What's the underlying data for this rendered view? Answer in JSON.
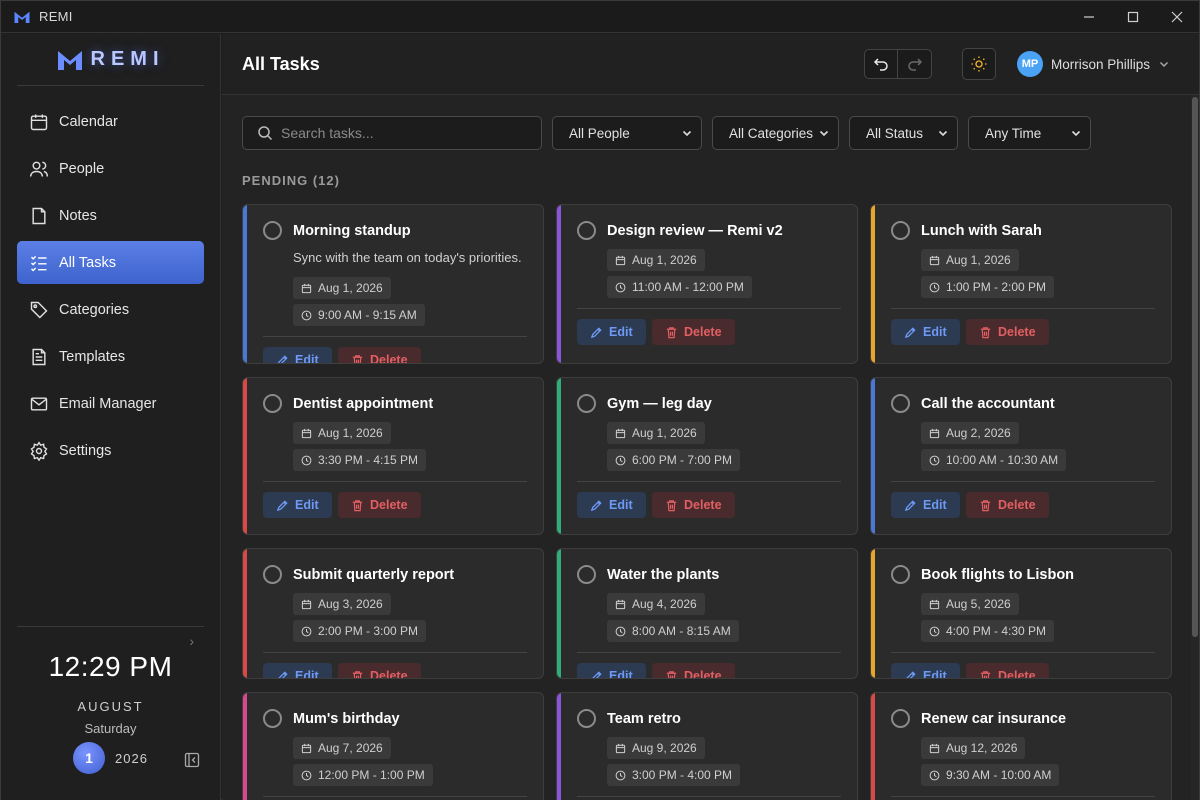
{
  "window": {
    "title": "REMI"
  },
  "brand": {
    "name": "REMI"
  },
  "sidebar": {
    "items": [
      {
        "label": "Calendar",
        "icon": "calendar-icon"
      },
      {
        "label": "People",
        "icon": "people-icon"
      },
      {
        "label": "Notes",
        "icon": "notes-icon"
      },
      {
        "label": "All Tasks",
        "icon": "tasks-icon",
        "active": true
      },
      {
        "label": "Categories",
        "icon": "tag-icon"
      },
      {
        "label": "Templates",
        "icon": "template-icon"
      },
      {
        "label": "Email Manager",
        "icon": "mail-icon"
      },
      {
        "label": "Settings",
        "icon": "gear-icon"
      }
    ],
    "clock": {
      "time": "12:29 PM",
      "month": "AUGUST",
      "weekday": "Saturday",
      "day": "1",
      "year": "2026"
    }
  },
  "header": {
    "title": "All Tasks",
    "user": {
      "initials": "MP",
      "name": "Morrison Phillips"
    }
  },
  "filters": {
    "search_placeholder": "Search tasks...",
    "people": "All People",
    "categories": "All Categories",
    "status": "All Status",
    "time": "Any Time"
  },
  "section": {
    "label": "PENDING (12)"
  },
  "actions": {
    "edit": "Edit",
    "delete": "Delete"
  },
  "colors": {
    "blue": "#4a78d6",
    "purple": "#8a55d6",
    "amber": "#e8a52b",
    "red": "#d94a46",
    "green": "#2fae78",
    "pink": "#d9478f"
  },
  "tasks": [
    {
      "title": "Morning standup",
      "description": "Sync with the team on today's priorities.",
      "date": "Aug 1, 2026",
      "time": "9:00 AM - 9:15 AM",
      "color": "#4a78d6"
    },
    {
      "title": "Design review — Remi v2",
      "description": "",
      "date": "Aug 1, 2026",
      "time": "11:00 AM - 12:00 PM",
      "color": "#8a55d6"
    },
    {
      "title": "Lunch with Sarah",
      "description": "",
      "date": "Aug 1, 2026",
      "time": "1:00 PM - 2:00 PM",
      "color": "#e8a52b"
    },
    {
      "title": "Dentist appointment",
      "description": "",
      "date": "Aug 1, 2026",
      "time": "3:30 PM - 4:15 PM",
      "color": "#d94a46"
    },
    {
      "title": "Gym — leg day",
      "description": "",
      "date": "Aug 1, 2026",
      "time": "6:00 PM - 7:00 PM",
      "color": "#2fae78"
    },
    {
      "title": "Call the accountant",
      "description": "",
      "date": "Aug 2, 2026",
      "time": "10:00 AM - 10:30 AM",
      "color": "#4a78d6"
    },
    {
      "title": "Submit quarterly report",
      "description": "",
      "date": "Aug 3, 2026",
      "time": "2:00 PM - 3:00 PM",
      "color": "#d94a46"
    },
    {
      "title": "Water the plants",
      "description": "",
      "date": "Aug 4, 2026",
      "time": "8:00 AM - 8:15 AM",
      "color": "#2fae78"
    },
    {
      "title": "Book flights to Lisbon",
      "description": "",
      "date": "Aug 5, 2026",
      "time": "4:00 PM - 4:30 PM",
      "color": "#e8a52b"
    },
    {
      "title": "Mum's birthday",
      "description": "",
      "date": "Aug 7, 2026",
      "time": "12:00 PM - 1:00 PM",
      "color": "#d9478f"
    },
    {
      "title": "Team retro",
      "description": "",
      "date": "Aug 9, 2026",
      "time": "3:00 PM - 4:00 PM",
      "color": "#8a55d6"
    },
    {
      "title": "Renew car insurance",
      "description": "",
      "date": "Aug 12, 2026",
      "time": "9:30 AM - 10:00 AM",
      "color": "#d94a46"
    }
  ]
}
